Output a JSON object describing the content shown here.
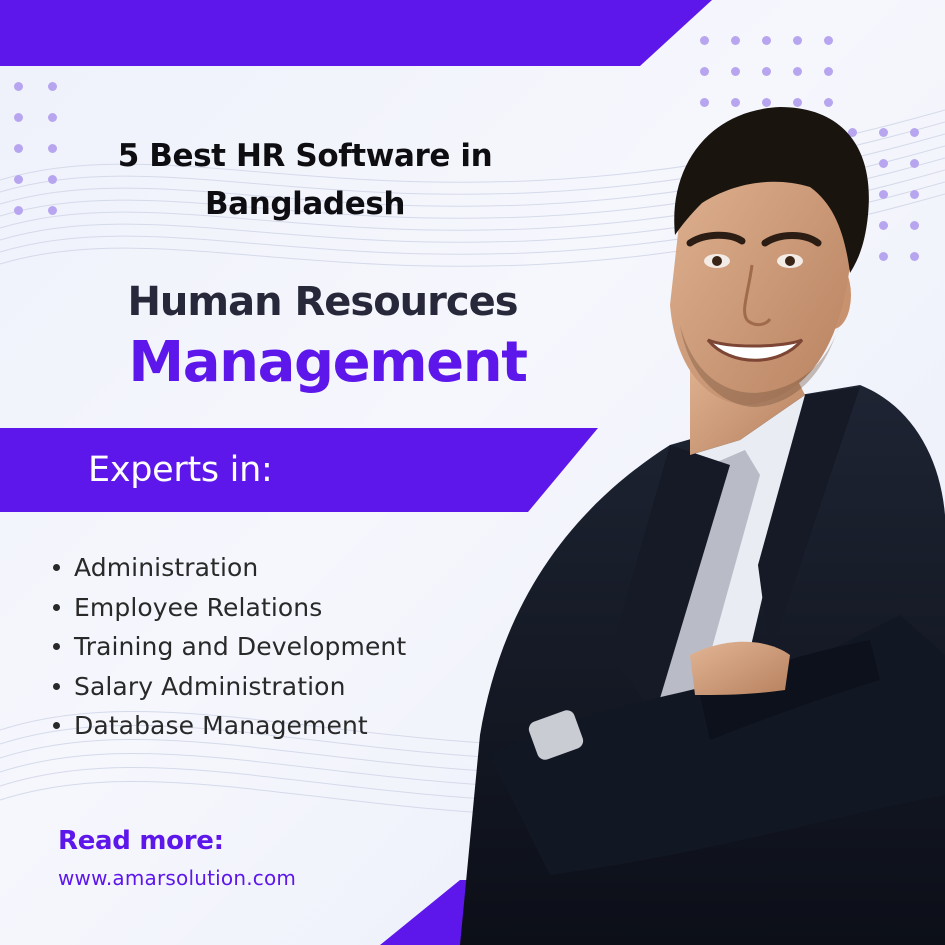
{
  "headline": {
    "line1": "5 Best HR Software in",
    "line2": "Bangladesh"
  },
  "subhead": {
    "line1": "Human Resources",
    "line2": "Management"
  },
  "banner": {
    "label": "Experts in:"
  },
  "skills": [
    "Administration",
    "Employee Relations",
    "Training and Development",
    "Salary Administration",
    "Database Management"
  ],
  "footer": {
    "read_more": "Read more:",
    "website": "www.amarsolution.com"
  },
  "colors": {
    "accent": "#5d17eb",
    "heading": "#27293a",
    "body_text": "#292929",
    "background": "#eef1fb",
    "dots": "#b7a6ef"
  },
  "icons": {
    "bullet": "bullet-dot-icon"
  }
}
